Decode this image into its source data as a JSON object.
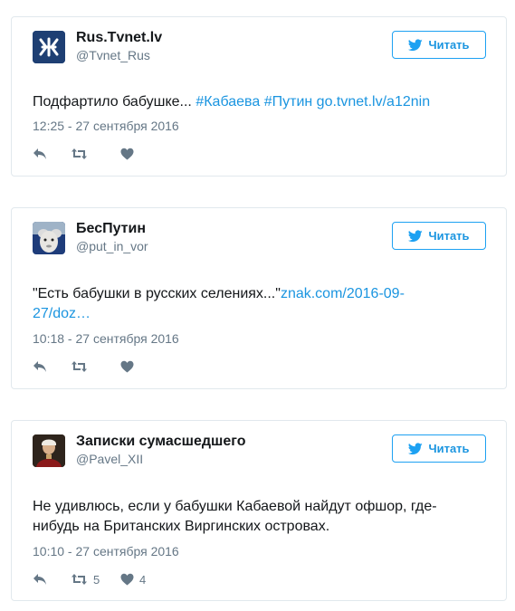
{
  "follow_label": "Читать",
  "colors": {
    "accent": "#1da1f2",
    "link": "#1b95e0",
    "muted": "#657786",
    "border": "#e1e8ed"
  },
  "tweets": [
    {
      "name": "Rus.Tvnet.lv",
      "handle": "@Tvnet_Rus",
      "avatar_icon": "tvnet-logo-icon",
      "text": "Подфартило бабушке... ",
      "hashtags": [
        "#Кабаева",
        "#Путин"
      ],
      "link": "go.tvnet.lv/a12nin",
      "timestamp": "12:25 - 27 сентября 2016",
      "retweet_count": "",
      "like_count": ""
    },
    {
      "name": "БесПутин",
      "handle": "@put_in_vor",
      "avatar_icon": "putin-puppet-avatar",
      "text": "\"Есть бабушки в русских селениях...\"",
      "link_line1": "znak.com/2016-09-",
      "link_line2": "27/doz…",
      "timestamp": "10:18 - 27 сентября 2016",
      "retweet_count": "",
      "like_count": ""
    },
    {
      "name": "Записки сумасшедшего",
      "handle": "@Pavel_XII",
      "avatar_icon": "portrait-avatar",
      "text_line1": "Не удивлюсь, если у бабушки Кабаевой найдут офшор, где-",
      "text_line2": "нибудь на Британских Виргинских островах.",
      "timestamp": "10:10 - 27 сентября 2016",
      "retweet_count": "5",
      "like_count": "4"
    }
  ]
}
